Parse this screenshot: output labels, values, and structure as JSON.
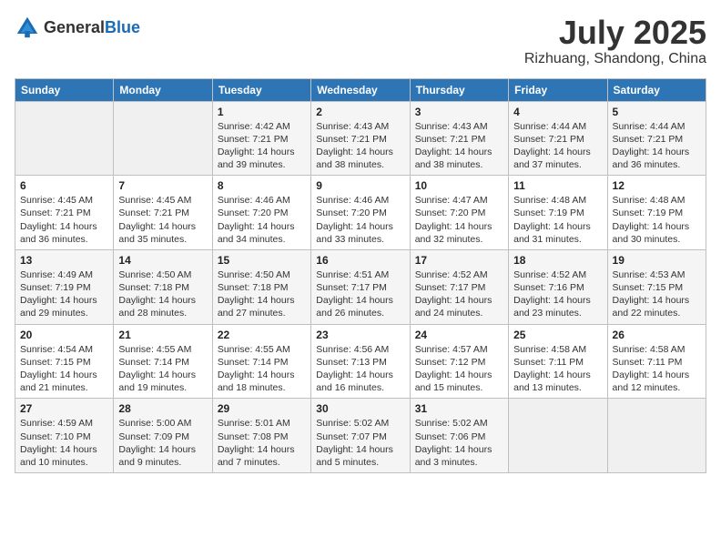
{
  "header": {
    "logo_general": "General",
    "logo_blue": "Blue",
    "month_title": "July 2025",
    "location": "Rizhuang, Shandong, China"
  },
  "weekdays": [
    "Sunday",
    "Monday",
    "Tuesday",
    "Wednesday",
    "Thursday",
    "Friday",
    "Saturday"
  ],
  "weeks": [
    [
      {
        "day": "",
        "info": ""
      },
      {
        "day": "",
        "info": ""
      },
      {
        "day": "1",
        "info": "Sunrise: 4:42 AM\nSunset: 7:21 PM\nDaylight: 14 hours and 39 minutes."
      },
      {
        "day": "2",
        "info": "Sunrise: 4:43 AM\nSunset: 7:21 PM\nDaylight: 14 hours and 38 minutes."
      },
      {
        "day": "3",
        "info": "Sunrise: 4:43 AM\nSunset: 7:21 PM\nDaylight: 14 hours and 38 minutes."
      },
      {
        "day": "4",
        "info": "Sunrise: 4:44 AM\nSunset: 7:21 PM\nDaylight: 14 hours and 37 minutes."
      },
      {
        "day": "5",
        "info": "Sunrise: 4:44 AM\nSunset: 7:21 PM\nDaylight: 14 hours and 36 minutes."
      }
    ],
    [
      {
        "day": "6",
        "info": "Sunrise: 4:45 AM\nSunset: 7:21 PM\nDaylight: 14 hours and 36 minutes."
      },
      {
        "day": "7",
        "info": "Sunrise: 4:45 AM\nSunset: 7:21 PM\nDaylight: 14 hours and 35 minutes."
      },
      {
        "day": "8",
        "info": "Sunrise: 4:46 AM\nSunset: 7:20 PM\nDaylight: 14 hours and 34 minutes."
      },
      {
        "day": "9",
        "info": "Sunrise: 4:46 AM\nSunset: 7:20 PM\nDaylight: 14 hours and 33 minutes."
      },
      {
        "day": "10",
        "info": "Sunrise: 4:47 AM\nSunset: 7:20 PM\nDaylight: 14 hours and 32 minutes."
      },
      {
        "day": "11",
        "info": "Sunrise: 4:48 AM\nSunset: 7:19 PM\nDaylight: 14 hours and 31 minutes."
      },
      {
        "day": "12",
        "info": "Sunrise: 4:48 AM\nSunset: 7:19 PM\nDaylight: 14 hours and 30 minutes."
      }
    ],
    [
      {
        "day": "13",
        "info": "Sunrise: 4:49 AM\nSunset: 7:19 PM\nDaylight: 14 hours and 29 minutes."
      },
      {
        "day": "14",
        "info": "Sunrise: 4:50 AM\nSunset: 7:18 PM\nDaylight: 14 hours and 28 minutes."
      },
      {
        "day": "15",
        "info": "Sunrise: 4:50 AM\nSunset: 7:18 PM\nDaylight: 14 hours and 27 minutes."
      },
      {
        "day": "16",
        "info": "Sunrise: 4:51 AM\nSunset: 7:17 PM\nDaylight: 14 hours and 26 minutes."
      },
      {
        "day": "17",
        "info": "Sunrise: 4:52 AM\nSunset: 7:17 PM\nDaylight: 14 hours and 24 minutes."
      },
      {
        "day": "18",
        "info": "Sunrise: 4:52 AM\nSunset: 7:16 PM\nDaylight: 14 hours and 23 minutes."
      },
      {
        "day": "19",
        "info": "Sunrise: 4:53 AM\nSunset: 7:15 PM\nDaylight: 14 hours and 22 minutes."
      }
    ],
    [
      {
        "day": "20",
        "info": "Sunrise: 4:54 AM\nSunset: 7:15 PM\nDaylight: 14 hours and 21 minutes."
      },
      {
        "day": "21",
        "info": "Sunrise: 4:55 AM\nSunset: 7:14 PM\nDaylight: 14 hours and 19 minutes."
      },
      {
        "day": "22",
        "info": "Sunrise: 4:55 AM\nSunset: 7:14 PM\nDaylight: 14 hours and 18 minutes."
      },
      {
        "day": "23",
        "info": "Sunrise: 4:56 AM\nSunset: 7:13 PM\nDaylight: 14 hours and 16 minutes."
      },
      {
        "day": "24",
        "info": "Sunrise: 4:57 AM\nSunset: 7:12 PM\nDaylight: 14 hours and 15 minutes."
      },
      {
        "day": "25",
        "info": "Sunrise: 4:58 AM\nSunset: 7:11 PM\nDaylight: 14 hours and 13 minutes."
      },
      {
        "day": "26",
        "info": "Sunrise: 4:58 AM\nSunset: 7:11 PM\nDaylight: 14 hours and 12 minutes."
      }
    ],
    [
      {
        "day": "27",
        "info": "Sunrise: 4:59 AM\nSunset: 7:10 PM\nDaylight: 14 hours and 10 minutes."
      },
      {
        "day": "28",
        "info": "Sunrise: 5:00 AM\nSunset: 7:09 PM\nDaylight: 14 hours and 9 minutes."
      },
      {
        "day": "29",
        "info": "Sunrise: 5:01 AM\nSunset: 7:08 PM\nDaylight: 14 hours and 7 minutes."
      },
      {
        "day": "30",
        "info": "Sunrise: 5:02 AM\nSunset: 7:07 PM\nDaylight: 14 hours and 5 minutes."
      },
      {
        "day": "31",
        "info": "Sunrise: 5:02 AM\nSunset: 7:06 PM\nDaylight: 14 hours and 3 minutes."
      },
      {
        "day": "",
        "info": ""
      },
      {
        "day": "",
        "info": ""
      }
    ]
  ]
}
